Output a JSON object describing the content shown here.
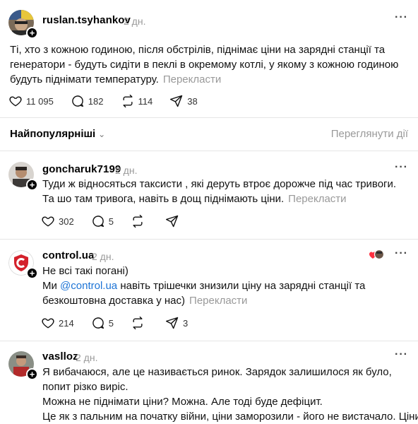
{
  "main_post": {
    "username": "ruslan.tsyhankov",
    "time": "2 дн.",
    "text": "Ті, хто з кожною годиною, після обстрілів, піднімає ціни на зарядні станції та генератори - будуть сидіти в пеклі в окремому котлі, у якому з кожною годиною будуть піднімати температуру.",
    "translate": "Перекласти",
    "likes": "11 095",
    "comments": "182",
    "reposts": "114",
    "shares": "38"
  },
  "sort": {
    "label": "Найпопулярніші",
    "view_activity": "Переглянути дії"
  },
  "replies": [
    {
      "username": "goncharuk7199",
      "time": "2 дн.",
      "text": "Туди ж відносяться таксисти , які деруть втроє дорожче під час тривоги. Та шо там тривога, навіть в дощ піднімають ціни.",
      "translate": "Перекласти",
      "likes": "302",
      "comments": "5"
    },
    {
      "username": "control.ua",
      "time": "2 дн.",
      "line1": "Не всі такі погані)",
      "line2_pre": "Ми ",
      "mention": "@control.ua",
      "line2_post": " навіть трішечки знизили ціну на зарядні станції та безкоштовна доставка у нас)",
      "translate": "Перекласти",
      "likes": "214",
      "comments": "5",
      "shares": "3"
    },
    {
      "username": "vaslloz",
      "time": "2 дн.",
      "para1": "Я вибачаюся, але це називається ринок. Зарядок залишилося як було, попит різко виріс.",
      "para2": "Можна не піднімати ціни? Можна. Але тоді буде дефіцит.",
      "para3": "Це як з пальним на початку війни, ціни заморозили - його не вистачало. Ціни"
    }
  ],
  "colors": {
    "link": "#1d74d6",
    "muted": "#999999",
    "divider": "#e6e6e6",
    "like_heart": "#ff3040"
  }
}
